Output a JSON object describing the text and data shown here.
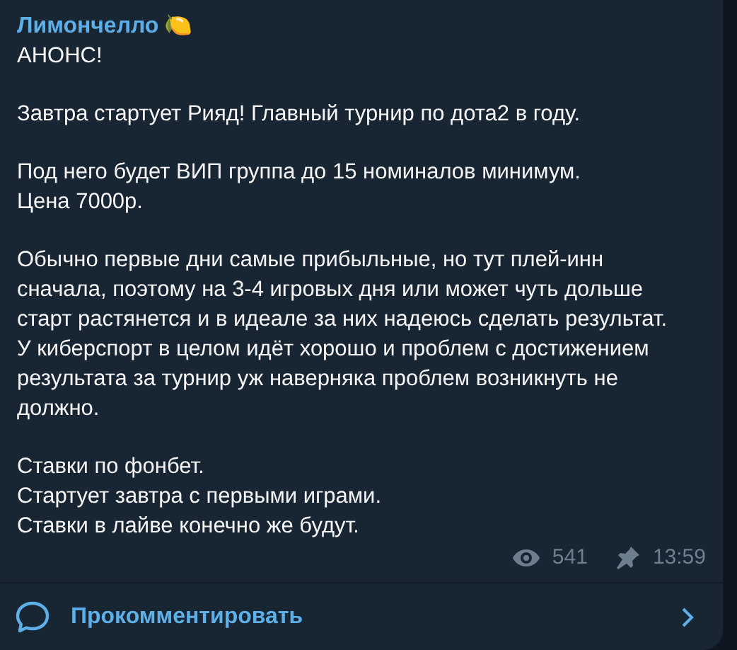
{
  "channel": {
    "name": "Лимончелло",
    "emoji": "🍋"
  },
  "paragraphs": [
    "АНОНС!",
    "Завтра стартует Рияд! Главный турнир по дота2 в году.",
    "Под него будет ВИП группа до 15 номиналов минимум.\nЦена 7000р.",
    "Обычно первые дни самые прибыльные, но тут плей-инн\nсначала, поэтому на 3-4 игровых дня или может чуть дольше\nстарт растянется и в идеале за них надеюсь сделать результат.\nУ киберспорт в целом идёт хорошо и проблем с достижением\nрезультата за турнир уж наверняка проблем возникнуть не\nдолжно.",
    "Ставки по фонбет.\nСтартует завтра с первыми играми.\nСтавки в лайве конечно же будут."
  ],
  "meta": {
    "views": "541",
    "pinned": true,
    "time": "13:59"
  },
  "comment_button": {
    "label": "Прокомментировать"
  }
}
